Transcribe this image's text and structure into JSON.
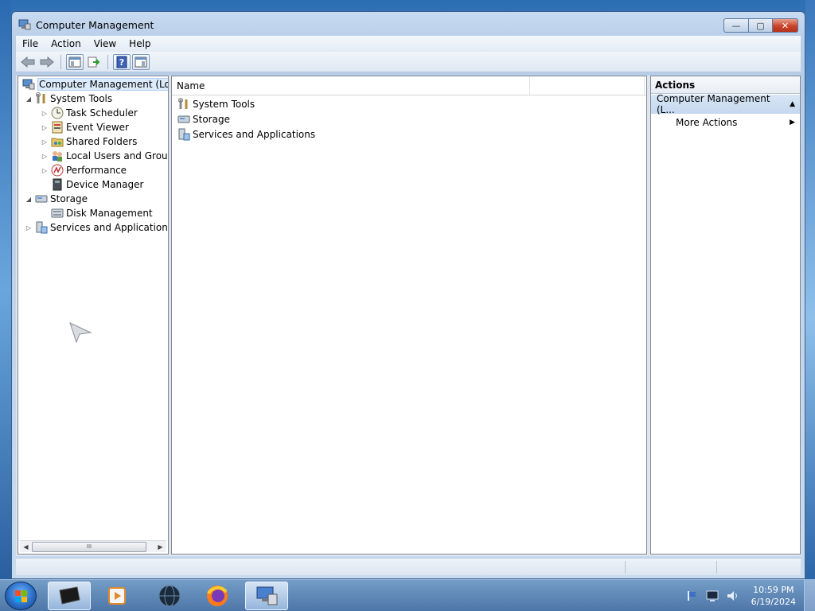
{
  "window": {
    "title": "Computer Management",
    "minimize": "—",
    "maximize": "▢",
    "close": "✕"
  },
  "menu": [
    "File",
    "Action",
    "View",
    "Help"
  ],
  "toolbar": {
    "icons": [
      "back-arrow-icon",
      "forward-arrow-icon",
      "show-hide-console-tree-icon",
      "export-list-icon",
      "help-icon",
      "show-hide-action-pane-icon"
    ]
  },
  "tree": {
    "root": "Computer Management (Local",
    "system_tools": "System Tools",
    "task_scheduler": "Task Scheduler",
    "event_viewer": "Event Viewer",
    "shared_folders": "Shared Folders",
    "local_users": "Local Users and Groups",
    "performance": "Performance",
    "device_manager": "Device Manager",
    "storage": "Storage",
    "disk_management": "Disk Management",
    "services_apps": "Services and Applications",
    "scroll_grip": "III"
  },
  "list": {
    "header_name": "Name",
    "items": [
      "System Tools",
      "Storage",
      "Services and Applications"
    ]
  },
  "actions": {
    "header": "Actions",
    "section": "Computer Management (L...",
    "more_actions": "More Actions"
  },
  "taskbar": {
    "time": "10:59 PM",
    "date": "6/19/2024"
  }
}
